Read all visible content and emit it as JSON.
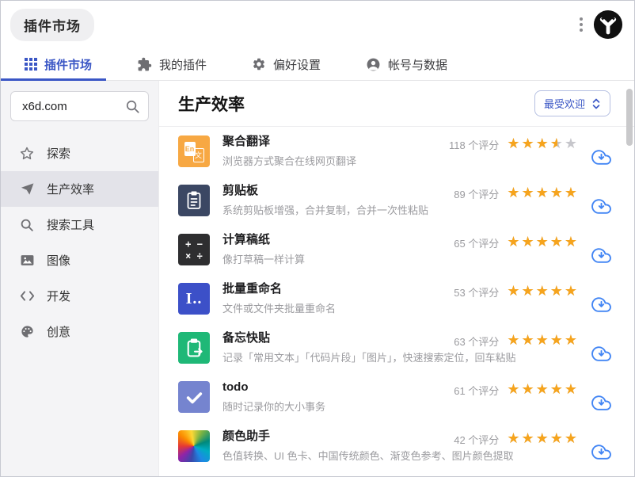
{
  "app": {
    "badge": "插件市场"
  },
  "tabs": [
    {
      "id": "market",
      "label": "插件市场",
      "icon": "grid-icon",
      "active": true
    },
    {
      "id": "my-plugins",
      "label": "我的插件",
      "icon": "puzzle-icon",
      "active": false
    },
    {
      "id": "preferences",
      "label": "偏好设置",
      "icon": "gear-icon",
      "active": false
    },
    {
      "id": "account",
      "label": "帐号与数据",
      "icon": "person-icon",
      "active": false
    }
  ],
  "sidebar": {
    "search": {
      "value": "x6d.com",
      "icon": "search-icon"
    },
    "items": [
      {
        "id": "explore",
        "label": "探索",
        "icon": "star-outline-icon",
        "active": false
      },
      {
        "id": "productivity",
        "label": "生产效率",
        "icon": "paper-plane-icon",
        "active": true
      },
      {
        "id": "search-tools",
        "label": "搜索工具",
        "icon": "search-icon",
        "active": false
      },
      {
        "id": "image",
        "label": "图像",
        "icon": "image-icon",
        "active": false
      },
      {
        "id": "develop",
        "label": "开发",
        "icon": "code-icon",
        "active": false
      },
      {
        "id": "creative",
        "label": "创意",
        "icon": "palette-icon",
        "active": false
      }
    ]
  },
  "main": {
    "title": "生产效率",
    "sort": {
      "label": "最受欢迎",
      "icon": "sort-arrows-icon"
    },
    "plugins": [
      {
        "name": "聚合翻译",
        "desc": "浏览器方式聚合在线网页翻译",
        "ratings": "118 个评分",
        "stars": 3.5,
        "icon": "translate-icon",
        "icon_bg": "#F7A843"
      },
      {
        "name": "剪贴板",
        "desc": "系统剪贴板增强，合并复制，合并一次性粘贴",
        "ratings": "89 个评分",
        "stars": 5,
        "icon": "clipboard-icon",
        "icon_bg": "#3B4763"
      },
      {
        "name": "计算稿纸",
        "desc": "像打草稿一样计算",
        "ratings": "65 个评分",
        "stars": 5,
        "icon": "calculator-icon",
        "icon_bg": "#2E2E30"
      },
      {
        "name": "批量重命名",
        "desc": "文件或文件夹批量重命名",
        "ratings": "53 个评分",
        "stars": 5,
        "icon": "rename-icon",
        "icon_bg": "#3C50C8"
      },
      {
        "name": "备忘快贴",
        "desc": "记录「常用文本」「代码片段」「图片」，快速搜索定位，回车粘贴",
        "ratings": "63 个评分",
        "stars": 5,
        "icon": "memo-paste-icon",
        "icon_bg": "#1FB877"
      },
      {
        "name": "todo",
        "desc": "随时记录你的大小事务",
        "ratings": "61 个评分",
        "stars": 5,
        "icon": "checkmark-icon",
        "icon_bg": "#7584CF"
      },
      {
        "name": "颜色助手",
        "desc": "色值转换、UI 色卡、中国传统颜色、渐变色参考、图片颜色提取",
        "ratings": "42 个评分",
        "stars": 5,
        "icon": "color-wheel-icon",
        "icon_bg": "conic"
      }
    ],
    "star_glyphs": "★★★★★"
  },
  "colors": {
    "accent": "#3A56C5",
    "star_full": "#F6A41D",
    "star_empty": "#C6C6CB",
    "download_blue": "#4285F4"
  }
}
